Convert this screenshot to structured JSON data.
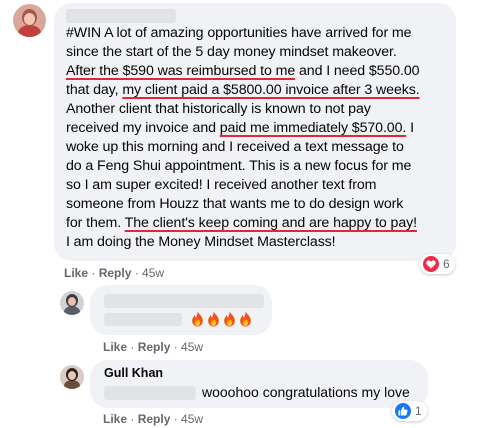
{
  "main_comment": {
    "post_lines": [
      "#WIN A lot of amazing opportunities have arrived for me",
      "since the start of the 5 day money mindset makeover.",
      "After the $590 was reimbursed to me",
      " and I need $550.00",
      "that day, ",
      "my client paid a $5800.00 invoice after 3 weeks.",
      "Another client that historically is known to not pay",
      "received my invoice and ",
      "paid me immediately $570.00.",
      " I",
      "woke up this morning and I received a text message to",
      "do a Feng Shui appointment. This is a new focus for me",
      "so I am super excited! I received another text from",
      "someone from Houzz that wants me to do design work",
      "for them. ",
      "The client's keep coming and are happy to pay!",
      "I am doing the Money Mindset Masterclass!"
    ],
    "like": "Like",
    "sep": " · ",
    "reply": "Reply",
    "time": "45w",
    "reaction_count": "6"
  },
  "reply1": {
    "like": "Like",
    "sep": " · ",
    "reply": "Reply",
    "time": "45w",
    "emoji_icons": [
      "fire-icon",
      "fire-icon",
      "fire-icon",
      "fire-icon"
    ]
  },
  "reply2": {
    "author": "Gull Khan",
    "text": "wooohoo congratulations my love",
    "like": "Like",
    "sep": " · ",
    "reply": "Reply",
    "time": "45w",
    "reaction_count": "1"
  },
  "colors": {
    "bubble": "#f0f2f5",
    "underline": "#e0283c",
    "meta_text": "#65676b",
    "love": "#f0284a",
    "like": "#1877f2"
  }
}
